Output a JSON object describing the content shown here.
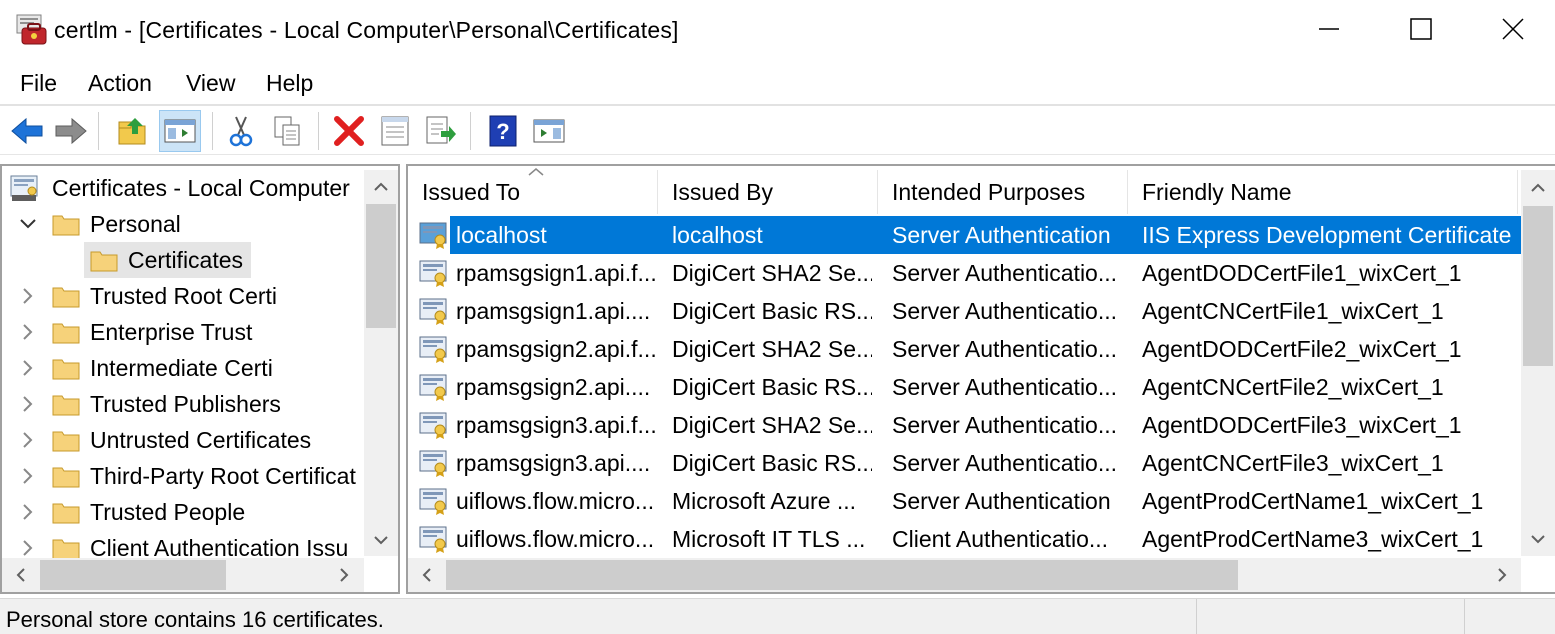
{
  "window": {
    "title": "certlm - [Certificates - Local Computer\\Personal\\Certificates]",
    "app_icon": "certificate-manager-icon"
  },
  "menu": [
    "File",
    "Action",
    "View",
    "Help"
  ],
  "toolbar": {
    "buttons": [
      "back-arrow-icon",
      "forward-arrow-icon",
      "up-folder-icon",
      "show-hide-console-tree-icon",
      "cut-icon",
      "copy-icon",
      "delete-icon",
      "properties-icon",
      "export-list-icon",
      "help-icon",
      "show-hide-action-pane-icon"
    ]
  },
  "tree": {
    "root": "Certificates - Local Computer",
    "items": [
      {
        "label": "Personal",
        "expanded": true
      },
      {
        "label": "Certificates",
        "selected": true
      },
      {
        "label": "Trusted Root Certi"
      },
      {
        "label": "Enterprise Trust"
      },
      {
        "label": "Intermediate Certi"
      },
      {
        "label": "Trusted Publishers"
      },
      {
        "label": "Untrusted Certificates"
      },
      {
        "label": "Third-Party Root Certificat"
      },
      {
        "label": "Trusted People"
      },
      {
        "label": "Client Authentication Issu"
      }
    ]
  },
  "list": {
    "columns": [
      "Issued To",
      "Issued By",
      "Intended Purposes",
      "Friendly Name"
    ],
    "sorted_column": "Issued To",
    "rows": [
      {
        "issued_to": "localhost",
        "issued_by": "localhost",
        "purposes": "Server Authentication",
        "friendly": "IIS Express Development Certificate",
        "selected": true
      },
      {
        "issued_to": "rpamsgsign1.api.f...",
        "issued_by": "DigiCert SHA2 Se...",
        "purposes": "Server Authenticatio...",
        "friendly": "AgentDODCertFile1_wixCert_1"
      },
      {
        "issued_to": "rpamsgsign1.api....",
        "issued_by": "DigiCert Basic RS...",
        "purposes": "Server Authenticatio...",
        "friendly": "AgentCNCertFile1_wixCert_1"
      },
      {
        "issued_to": "rpamsgsign2.api.f...",
        "issued_by": "DigiCert SHA2 Se...",
        "purposes": "Server Authenticatio...",
        "friendly": "AgentDODCertFile2_wixCert_1"
      },
      {
        "issued_to": "rpamsgsign2.api....",
        "issued_by": "DigiCert Basic RS...",
        "purposes": "Server Authenticatio...",
        "friendly": "AgentCNCertFile2_wixCert_1"
      },
      {
        "issued_to": "rpamsgsign3.api.f...",
        "issued_by": "DigiCert SHA2 Se...",
        "purposes": "Server Authenticatio...",
        "friendly": "AgentDODCertFile3_wixCert_1"
      },
      {
        "issued_to": "rpamsgsign3.api....",
        "issued_by": "DigiCert Basic RS...",
        "purposes": "Server Authenticatio...",
        "friendly": "AgentCNCertFile3_wixCert_1"
      },
      {
        "issued_to": "uiflows.flow.micro...",
        "issued_by": "Microsoft Azure ...",
        "purposes": "Server Authentication",
        "friendly": "AgentProdCertName1_wixCert_1"
      },
      {
        "issued_to": "uiflows.flow.micro...",
        "issued_by": "Microsoft IT TLS ...",
        "purposes": "Client Authenticatio...",
        "friendly": "AgentProdCertName3_wixCert_1"
      }
    ]
  },
  "status": {
    "text": "Personal store contains 16 certificates."
  },
  "colors": {
    "selection": "#0078d7",
    "toolbar_active": "#cce4f7"
  }
}
